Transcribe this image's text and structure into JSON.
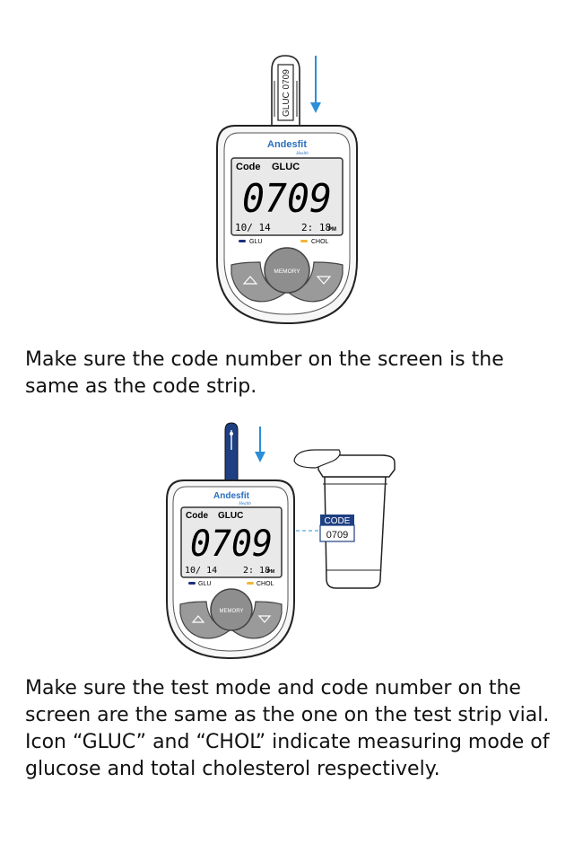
{
  "meter": {
    "brand": "Andesfit",
    "brand_sub": "Health",
    "screen_code_label": "Code",
    "screen_mode": "GLUC",
    "screen_code_number": "0709",
    "screen_date": "10/ 14",
    "screen_time": "2: 18",
    "screen_ampm": "PM",
    "glu_label": "GLU",
    "chol_label": "CHOL",
    "memory_label": "MEMORY"
  },
  "code_strip": {
    "text": "GLUC 0709"
  },
  "vial": {
    "label_top": "CODE",
    "label_number": "0709"
  },
  "colors": {
    "arrow": "#2a8fd8",
    "glu_dot": "#1b2f7a",
    "chol_dot": "#f2b632",
    "strip_blue": "#1e3f82",
    "button_gray": "#9a9a9a"
  },
  "instructions": [
    {
      "lines": [
        "Make sure the code number on the screen is the",
        "same as the code strip."
      ]
    },
    {
      "lines": [
        "Make sure the test mode and code number on the",
        "screen are the same as the one on the test strip vial.",
        "Icon “GLUC” and “CHOL” indicate measuring mode of",
        "glucose and total cholesterol respectively."
      ]
    }
  ]
}
